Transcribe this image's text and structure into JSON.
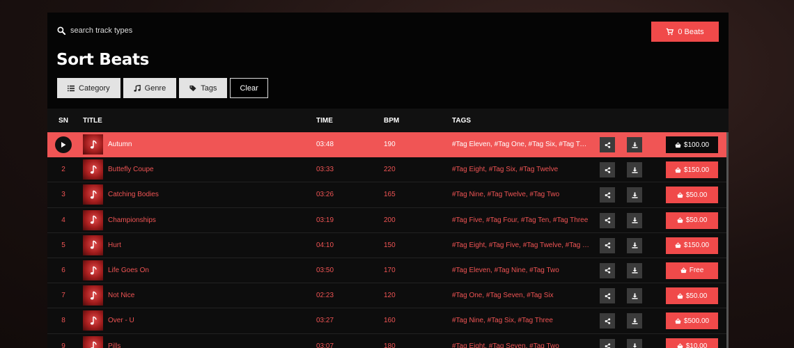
{
  "search": {
    "placeholder": "search track types",
    "icon": "search-icon"
  },
  "cart": {
    "label": "0 Beats",
    "icon": "cart-icon"
  },
  "page_title": "Sort Beats",
  "filters": [
    {
      "label": "Category",
      "icon": "list-icon"
    },
    {
      "label": "Genre",
      "icon": "music-note-icon"
    },
    {
      "label": "Tags",
      "icon": "tag-icon"
    },
    {
      "label": "Clear"
    }
  ],
  "table": {
    "headers": {
      "sn": "SN",
      "title": "TITLE",
      "time": "TIME",
      "bpm": "BPM",
      "tags": "TAGS"
    },
    "rows": [
      {
        "sn": "",
        "title": "Autumn",
        "time": "03:48",
        "bpm": "190",
        "tags": "#Tag Eleven,  #Tag One,  #Tag Six,  #Tag Twelve",
        "price": "$100.00",
        "active": true
      },
      {
        "sn": "2",
        "title": "Buttefly Coupe",
        "time": "03:33",
        "bpm": "220",
        "tags": "#Tag Eight,  #Tag Six,  #Tag Twelve",
        "price": "$150.00"
      },
      {
        "sn": "3",
        "title": "Catching Bodies",
        "time": "03:26",
        "bpm": "165",
        "tags": "#Tag Nine,  #Tag Twelve,  #Tag Two",
        "price": "$50.00"
      },
      {
        "sn": "4",
        "title": "Championships",
        "time": "03:19",
        "bpm": "200",
        "tags": "#Tag Five,  #Tag Four,  #Tag Ten,  #Tag Three",
        "price": "$50.00"
      },
      {
        "sn": "5",
        "title": "Hurt",
        "time": "04:10",
        "bpm": "150",
        "tags": "#Tag Eight,  #Tag Five,  #Tag Twelve,  #Tag Two",
        "price": "$150.00"
      },
      {
        "sn": "6",
        "title": "Life Goes On",
        "time": "03:50",
        "bpm": "170",
        "tags": "#Tag Eleven,  #Tag Nine,  #Tag Two",
        "price": "Free"
      },
      {
        "sn": "7",
        "title": "Not Nice",
        "time": "02:23",
        "bpm": "120",
        "tags": "#Tag One,  #Tag Seven,  #Tag Six",
        "price": "$50.00"
      },
      {
        "sn": "8",
        "title": "Over - U",
        "time": "03:27",
        "bpm": "160",
        "tags": "#Tag Nine,  #Tag Six,  #Tag Three",
        "price": "$500.00"
      },
      {
        "sn": "9",
        "title": "Pills",
        "time": "03:07",
        "bpm": "180",
        "tags": "#Tag Eight,  #Tag Seven,  #Tag Two",
        "price": "$10.00"
      }
    ]
  },
  "colors": {
    "accent": "#f04a4a",
    "panel": "#050505",
    "row": "#0d0d0d"
  }
}
